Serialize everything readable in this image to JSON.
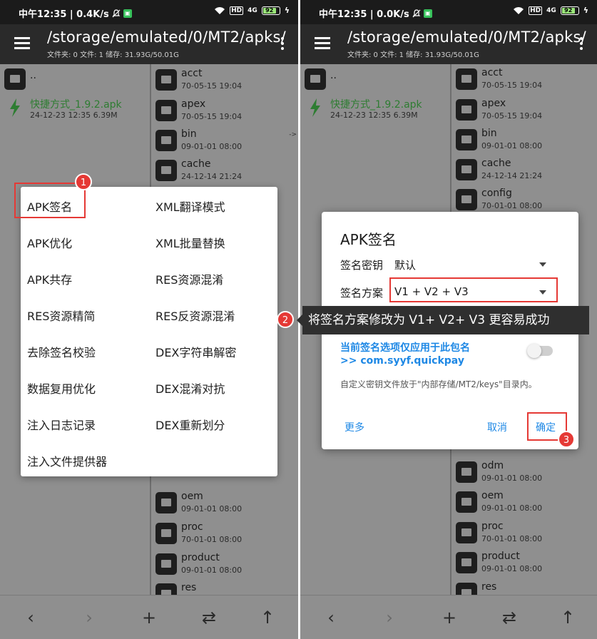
{
  "status": {
    "left": {
      "time_text": "中午12:35 | 0.4K/s",
      "icon": "bell-off-icon"
    },
    "right": {
      "time_text": "中午12:35 | 0.0K/s",
      "icon": "bell-off-icon"
    },
    "hd": "HD",
    "net": "4G",
    "battery": "92"
  },
  "toolbar": {
    "path": "/storage/emulated/0/MT2/apks/",
    "info": "文件夹: 0  文件: 1  储存: 31.93G/50.01G"
  },
  "left_pane": {
    "parent": "..",
    "apk": {
      "name": "快捷方式_1.9.2.apk",
      "meta": "24-12-23 12:35  6.39M"
    }
  },
  "folders": [
    {
      "name": "acct",
      "date": "70-05-15 19:04"
    },
    {
      "name": "apex",
      "date": "70-05-15 19:04"
    },
    {
      "name": "bin",
      "date": "09-01-01 08:00"
    },
    {
      "name": "cache",
      "date": "24-12-14 21:24"
    },
    {
      "name": "config",
      "date": "70-01-01 08:00"
    },
    {
      "name": "odm",
      "date": "09-01-01 08:00"
    },
    {
      "name": "oem",
      "date": "09-01-01 08:00"
    },
    {
      "name": "proc",
      "date": "70-01-01 08:00"
    },
    {
      "name": "product",
      "date": "09-01-01 08:00"
    },
    {
      "name": "res",
      "date": ""
    }
  ],
  "arrow_text": "->",
  "menu": {
    "col1": [
      "APK签名",
      "APK优化",
      "APK共存",
      "RES资源精简",
      "去除签名校验",
      "数据复用优化",
      "注入日志记录",
      "注入文件提供器"
    ],
    "col2": [
      "XML翻译模式",
      "XML批量替换",
      "RES资源混淆",
      "RES反资源混淆",
      "DEX字符串解密",
      "DEX混淆对抗",
      "DEX重新划分"
    ]
  },
  "dialog": {
    "title": "APK签名",
    "key_label": "签名密钥",
    "key_value": "默认",
    "scheme_label": "签名方案",
    "scheme_value": "V1 + V2 + V3",
    "apply_link": "当前签名选项仅应用于此包名",
    "package_link": ">> com.syyf.quickpay",
    "note": "自定义密钥文件放于\"内部存储/MT2/keys\"目录内。",
    "more": "更多",
    "cancel": "取消",
    "ok": "确定"
  },
  "tip": "将签名方案修改为 V1+ V2+ V3 更容易成功",
  "badges": [
    "1",
    "2",
    "3"
  ],
  "bottom": {
    "back": "‹",
    "forward": "›",
    "add": "+",
    "swap": "⇄",
    "up": "↑"
  },
  "colors": {
    "accent_red": "#e53935",
    "link_blue": "#1e88e5",
    "apk_green": "#2e7d32"
  }
}
